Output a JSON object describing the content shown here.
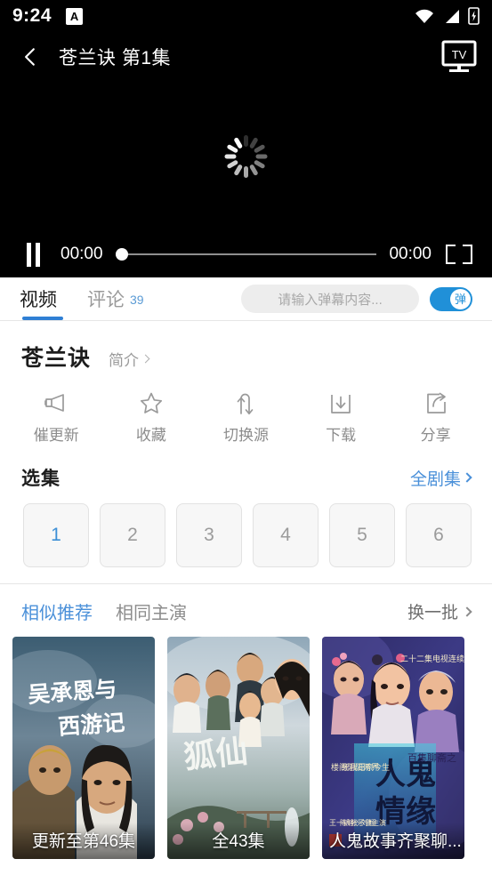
{
  "status_bar": {
    "time": "9:24",
    "badge": "A",
    "icons": [
      "wifi-icon",
      "signal-icon",
      "battery-charging-icon"
    ]
  },
  "title_bar": {
    "back_icon": "back-chevron-icon",
    "title": "苍兰诀 第1集",
    "cast_icon": "tv-cast-icon",
    "cast_label": "TV"
  },
  "player": {
    "state": "loading",
    "spinner_icon": "loading-spinner-icon",
    "pause_icon": "pause-icon",
    "current_time": "00:00",
    "total_time": "00:00",
    "progress_percent": 0,
    "fullscreen_icon": "fullscreen-icon"
  },
  "tabs": {
    "items": [
      {
        "label": "视频",
        "count": "",
        "active": true
      },
      {
        "label": "评论",
        "count": "39",
        "active": false
      }
    ],
    "danmaku_placeholder": "请输入弹幕内容...",
    "danmaku_toggle_label": "弹",
    "danmaku_toggle_on": true,
    "accent_color": "#2f7fd4"
  },
  "show": {
    "title": "苍兰诀",
    "desc_label": "简介"
  },
  "actions": [
    {
      "label": "催更新",
      "icon": "megaphone-icon"
    },
    {
      "label": "收藏",
      "icon": "star-icon"
    },
    {
      "label": "切换源",
      "icon": "swap-arrows-icon"
    },
    {
      "label": "下载",
      "icon": "download-icon"
    },
    {
      "label": "分享",
      "icon": "share-icon"
    }
  ],
  "episodes": {
    "section_title": "选集",
    "all_label": "全剧集",
    "items": [
      {
        "label": "1",
        "selected": true
      },
      {
        "label": "2",
        "selected": false
      },
      {
        "label": "3",
        "selected": false
      },
      {
        "label": "4",
        "selected": false
      },
      {
        "label": "5",
        "selected": false
      },
      {
        "label": "6",
        "selected": false
      }
    ]
  },
  "recommend": {
    "tabs": [
      {
        "label": "相似推荐",
        "active": true
      },
      {
        "label": "相同主演",
        "active": false
      }
    ],
    "refresh_label": "换一批",
    "cards": [
      {
        "title": "吴承恩与西游记",
        "title_line1": "吴承恩与",
        "title_line2": "西游记",
        "caption": "更新至第46集"
      },
      {
        "title": "狐仙",
        "title_line1": "狐仙",
        "title_line2": "",
        "caption": "全43集"
      },
      {
        "title": "人鬼情缘",
        "title_line1": "人鬼情缘",
        "title_line2": "二十二集电视连续剧",
        "caption": "人鬼故事齐聚聊..."
      }
    ]
  }
}
